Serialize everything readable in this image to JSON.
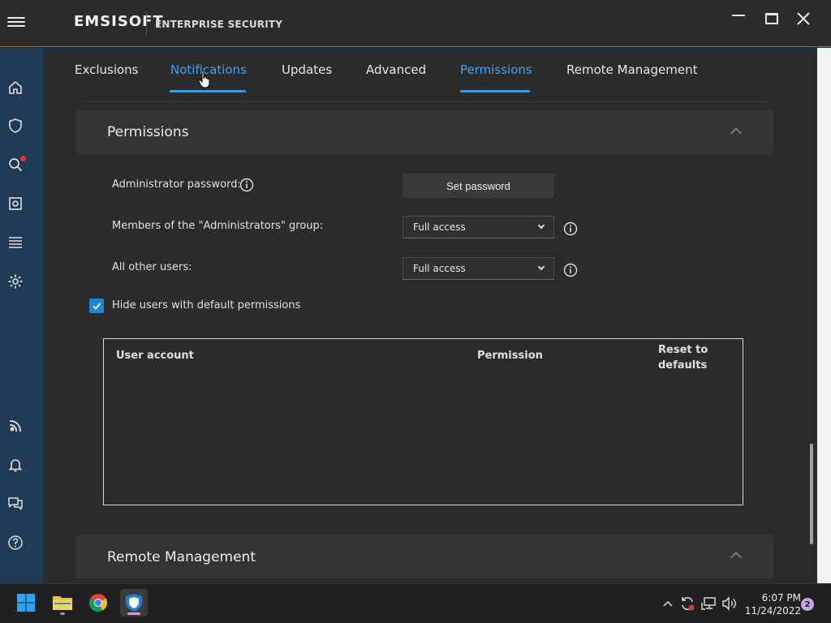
{
  "app": {
    "brand": "EMSISOFT",
    "subtitle": "ENTERPRISE SECURITY"
  },
  "tabs": [
    {
      "label": "Exclusions",
      "active": false
    },
    {
      "label": "Notifications",
      "active": true
    },
    {
      "label": "Updates",
      "active": false
    },
    {
      "label": "Advanced",
      "active": false
    },
    {
      "label": "Permissions",
      "active": true
    },
    {
      "label": "Remote Management",
      "active": false
    }
  ],
  "sidebar": {
    "items": [
      "home-icon",
      "shield-icon",
      "scan-icon",
      "quarantine-icon",
      "logs-icon",
      "settings-icon",
      "connection-icon",
      "bell-icon",
      "chat-icon",
      "help-icon"
    ],
    "scan_has_alert": true
  },
  "permissions": {
    "title": "Permissions",
    "admin_password_label": "Administrator password:",
    "set_password_button": "Set password",
    "admin_group_label": "Members of the \"Administrators\" group:",
    "admin_group_value": "Full access",
    "other_users_label": "All other users:",
    "other_users_value": "Full access",
    "hide_default_label": "Hide users with default permissions",
    "hide_default_checked": true,
    "table": {
      "col_user": "User account",
      "col_permission": "Permission",
      "col_reset": "Reset to defaults",
      "rows": []
    }
  },
  "remote": {
    "title": "Remote Management"
  },
  "taskbar": {
    "apps": [
      "windows-start-icon",
      "file-explorer-icon",
      "chrome-icon",
      "emsisoft-icon"
    ],
    "time": "6:07 PM",
    "date": "11/24/2022",
    "notification_count": "2"
  },
  "colors": {
    "accent": "#2e9cf0",
    "rail": "#1e3a55",
    "background": "#2b2b2b"
  }
}
